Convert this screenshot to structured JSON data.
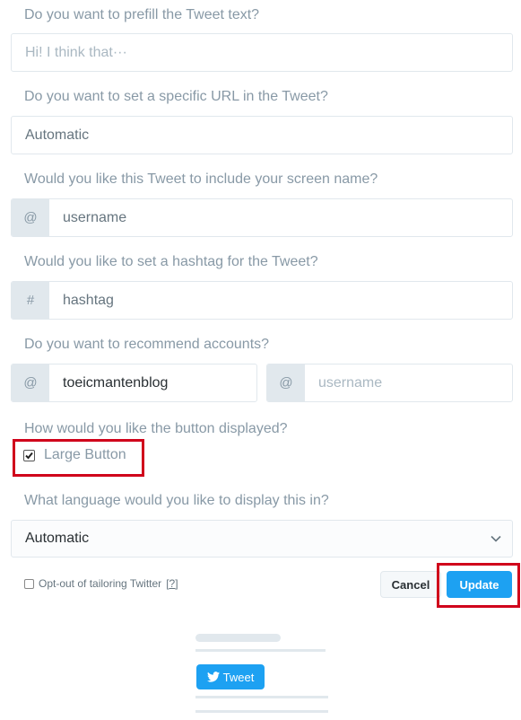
{
  "questions": {
    "prefill": "Do you want to prefill the Tweet text?",
    "url": "Do you want to set a specific URL in the Tweet?",
    "screen_name": "Would you like this Tweet to include your screen name?",
    "hashtag": "Would you like to set a hashtag for the Tweet?",
    "recommend": "Do you want to recommend accounts?",
    "button_display": "How would you like the button displayed?",
    "language": "What language would you like to display this in?"
  },
  "fields": {
    "prefill_placeholder": "Hi! I think that···",
    "url_placeholder": "Automatic",
    "screen_name_prefix": "@",
    "screen_name_placeholder": "username",
    "hashtag_prefix": "#",
    "hashtag_placeholder": "hashtag",
    "recommend_1_prefix": "@",
    "recommend_1_value": "toeicmantenblog",
    "recommend_2_prefix": "@",
    "recommend_2_placeholder": "username",
    "language_value": "Automatic"
  },
  "large_button": {
    "label": "Large Button",
    "checked": true
  },
  "opt_out": {
    "label": "Opt-out of tailoring Twitter",
    "help": "[?]",
    "checked": false
  },
  "actions": {
    "cancel": "Cancel",
    "update": "Update"
  },
  "preview": {
    "tweet_button": "Tweet"
  },
  "colors": {
    "accent": "#1da1f2",
    "highlight": "#d0021b"
  },
  "icons": {
    "checkbox": "checkbox-icon",
    "chevron": "chevron-down-icon",
    "bird": "twitter-bird-icon"
  }
}
